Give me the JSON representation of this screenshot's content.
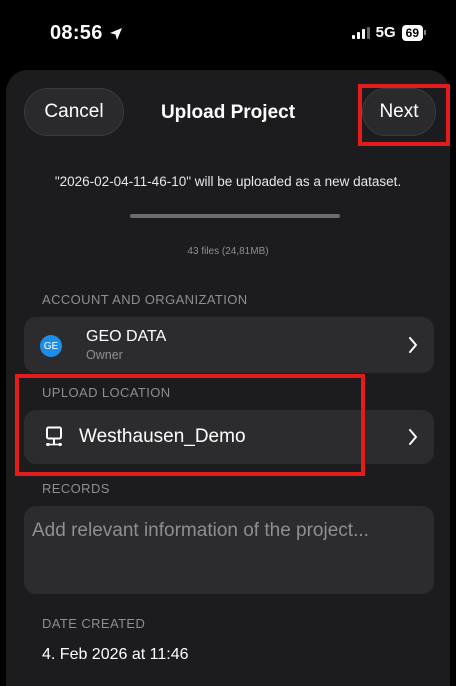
{
  "status_bar": {
    "time": "08:56",
    "network": "5G",
    "battery": "69"
  },
  "header": {
    "cancel_label": "Cancel",
    "title": "Upload Project",
    "next_label": "Next"
  },
  "upload": {
    "notice": "\"2026-02-04-11-46-10\" will be uploaded as a new dataset.",
    "progress_fraction": 1.0,
    "file_summary": "43 files (24,81MB)"
  },
  "account": {
    "section_label": "ACCOUNT AND ORGANIZATION",
    "avatar_initials": "GE",
    "name": "GEO DATA",
    "role": "Owner"
  },
  "location": {
    "section_label": "UPLOAD LOCATION",
    "name": "Westhausen_Demo"
  },
  "records": {
    "section_label": "RECORDS",
    "placeholder": "Add relevant information of the project..."
  },
  "date_created": {
    "section_label": "DATE CREATED",
    "value": "4. Feb 2026 at 11:46"
  },
  "colors": {
    "highlight": "#e31b1b",
    "avatar": "#1d8de8",
    "sheet": "#1c1c1e",
    "card": "#2c2c2e"
  }
}
